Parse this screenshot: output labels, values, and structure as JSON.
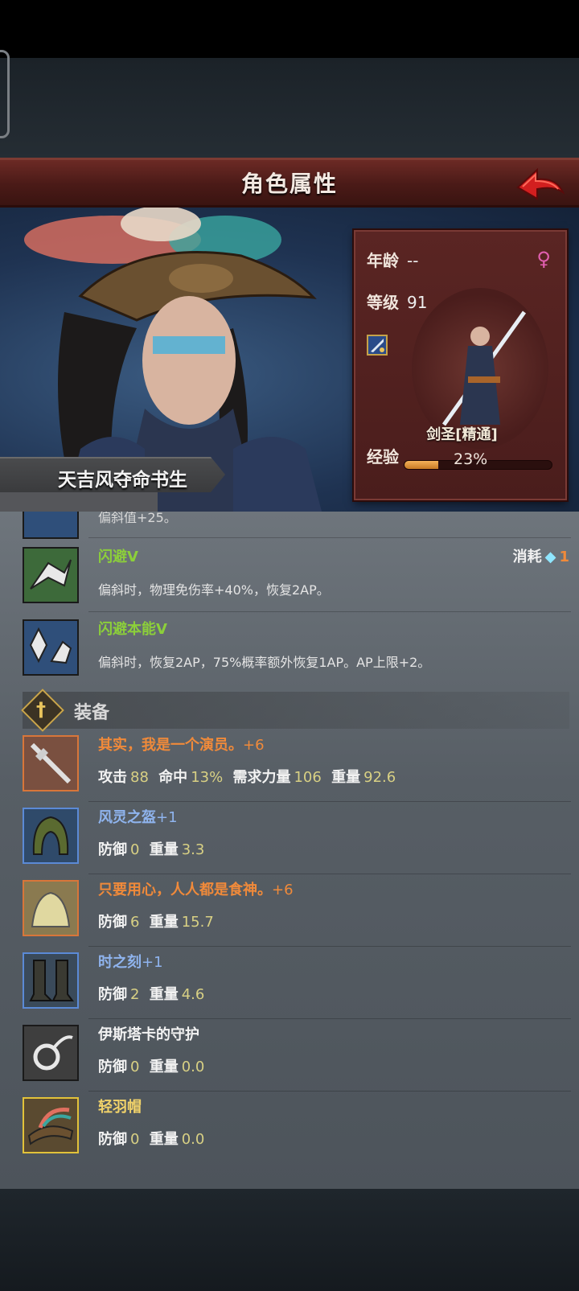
{
  "header": {
    "title": "角色属性"
  },
  "character": {
    "name": "天吉风夺命书生",
    "age_label": "年龄",
    "age_value": "--",
    "level_label": "等级",
    "level_value": "91",
    "class_label": "剑圣[精通]",
    "exp_label": "经验",
    "exp_percent": 23,
    "exp_text": "23%"
  },
  "clipped_skill_text": "偏斜值+25。",
  "skills": [
    {
      "name": "闪避V",
      "desc": "偏斜时，物理免伤率+40%，恢复2AP。",
      "cost_label": "消耗",
      "cost_value": "1",
      "icon": "dodge-icon"
    },
    {
      "name": "闪避本能V",
      "desc": "偏斜时，恢复2AP，75%概率额外恢复1AP。AP上限+2。",
      "icon": "dodge-instinct-icon"
    }
  ],
  "equipment_section": {
    "title": "装备"
  },
  "equipment": [
    {
      "name": "其实，我是一个演员。",
      "plus": "+6",
      "color": "#f08a3a",
      "border": "#d8763a",
      "icon": "weapon-icon",
      "stats": [
        {
          "label": "攻击",
          "value": "88"
        },
        {
          "label": "命中",
          "value": "13%"
        },
        {
          "label": "需求力量",
          "value": "106"
        },
        {
          "label": "重量",
          "value": "92.6"
        }
      ]
    },
    {
      "name": "风灵之盔",
      "plus": "+1",
      "color": "#8fb4ee",
      "border": "#5b8ad6",
      "icon": "helmet-icon",
      "stats": [
        {
          "label": "防御",
          "value": "0"
        },
        {
          "label": "重量",
          "value": "3.3"
        }
      ]
    },
    {
      "name": "只要用心，人人都是食神。",
      "plus": "+6",
      "color": "#f08a3a",
      "border": "#d8763a",
      "icon": "armor-icon",
      "stats": [
        {
          "label": "防御",
          "value": "6"
        },
        {
          "label": "重量",
          "value": "15.7"
        }
      ]
    },
    {
      "name": "时之刻",
      "plus": "+1",
      "color": "#8fb4ee",
      "border": "#5b8ad6",
      "icon": "boots-icon",
      "stats": [
        {
          "label": "防御",
          "value": "2"
        },
        {
          "label": "重量",
          "value": "4.6"
        }
      ]
    },
    {
      "name": "伊斯塔卡的守护",
      "plus": "",
      "color": "#f2f2f2",
      "border": "#1a1a1a",
      "icon": "amulet-icon",
      "stats": [
        {
          "label": "防御",
          "value": "0"
        },
        {
          "label": "重量",
          "value": "0.0"
        }
      ]
    },
    {
      "name": "轻羽帽",
      "plus": "",
      "color": "#f2d36a",
      "border": "#e2c23a",
      "icon": "feather-hat-icon",
      "stats": [
        {
          "label": "防御",
          "value": "0"
        },
        {
          "label": "重量",
          "value": "0.0"
        }
      ]
    }
  ]
}
